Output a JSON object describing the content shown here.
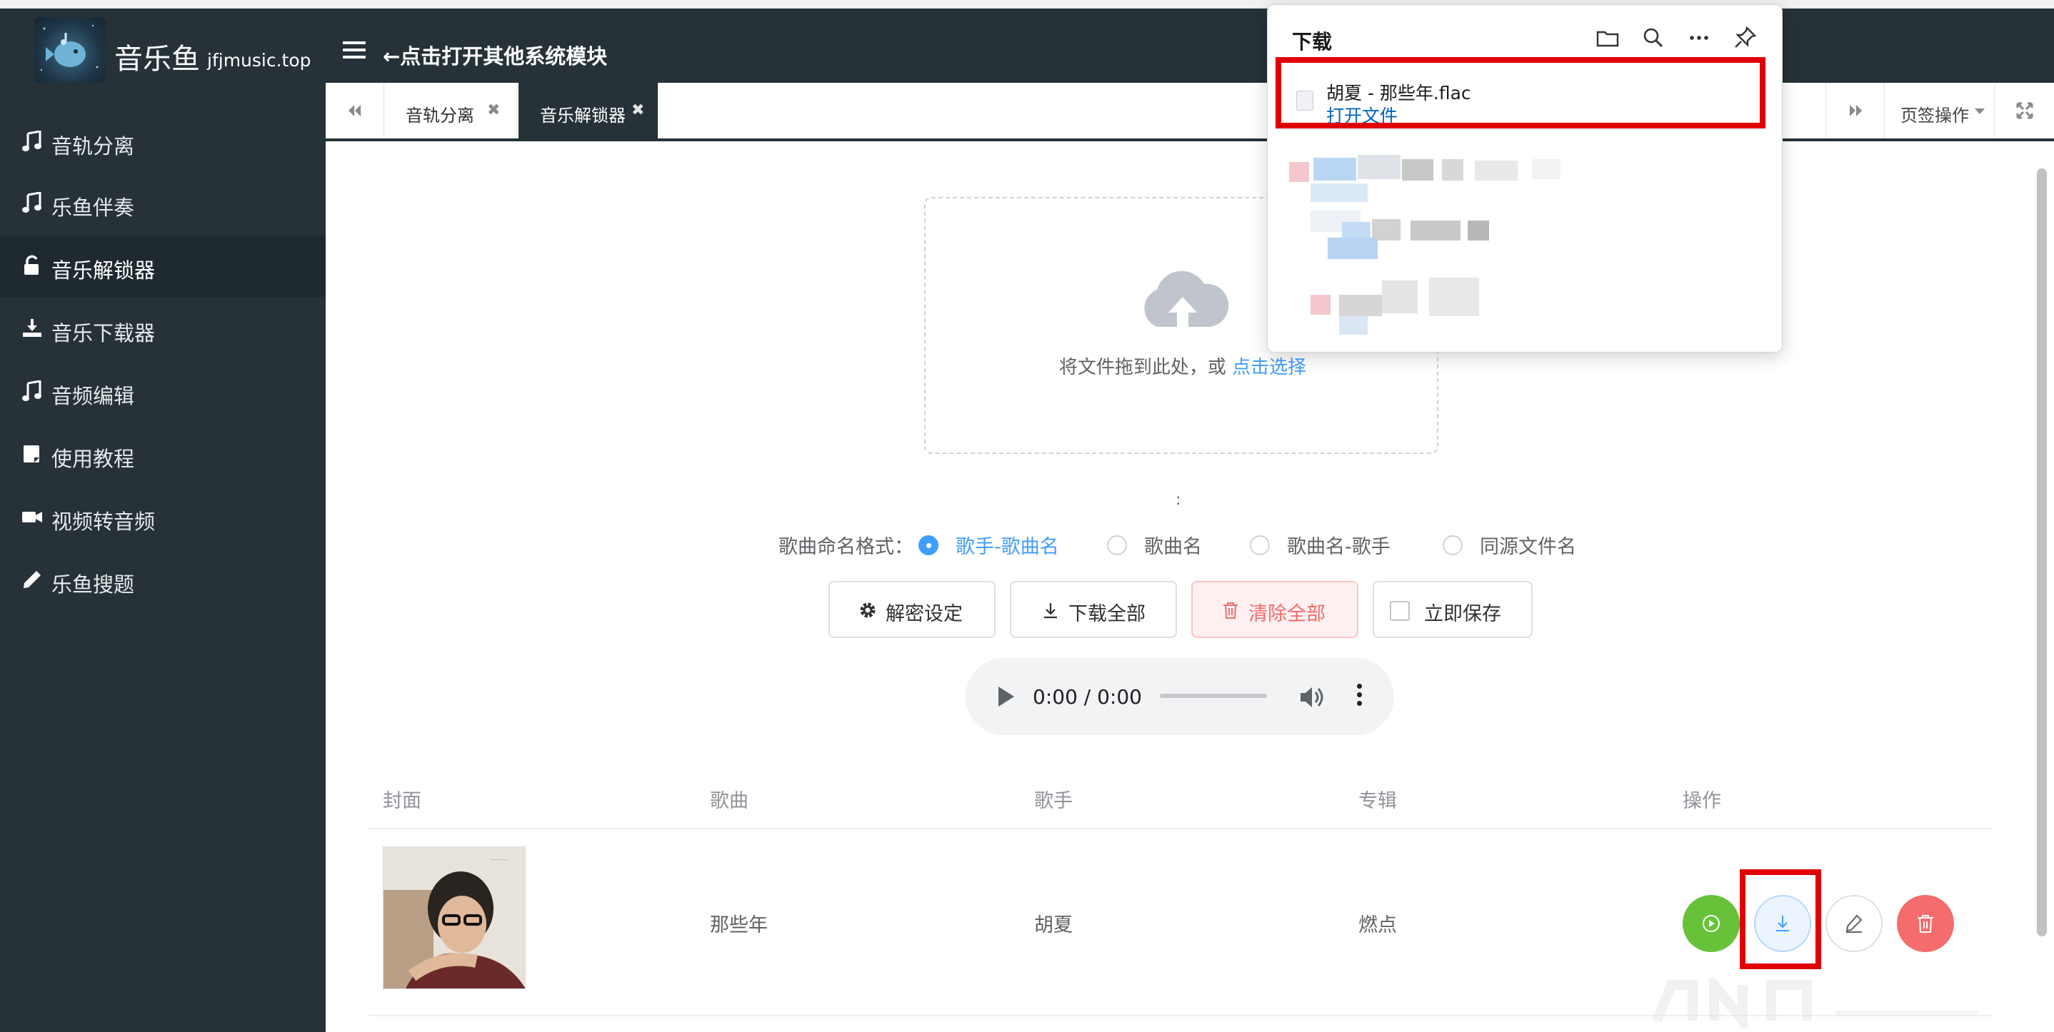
{
  "header": {
    "brand_name": "音乐鱼",
    "brand_url": "jfjmusic.top",
    "hint": "←点击打开其他系统模块"
  },
  "sidebar": {
    "items": [
      {
        "label": "音轨分离",
        "icon": "music-note-icon"
      },
      {
        "label": "乐鱼伴奏",
        "icon": "music-note-icon"
      },
      {
        "label": "音乐解锁器",
        "icon": "unlock-icon",
        "active": true
      },
      {
        "label": "音乐下载器",
        "icon": "download-icon"
      },
      {
        "label": "音频编辑",
        "icon": "music-note-icon"
      },
      {
        "label": "使用教程",
        "icon": "book-icon"
      },
      {
        "label": "视频转音频",
        "icon": "video-camera-icon"
      },
      {
        "label": "乐鱼搜题",
        "icon": "pencil-icon"
      }
    ]
  },
  "tabs": {
    "items": [
      {
        "label": "音轨分离",
        "active": false
      },
      {
        "label": "音乐解锁器",
        "active": true
      }
    ],
    "page_ops_label": "页签操作"
  },
  "upload": {
    "text": "将文件拖到此处，或",
    "link": "点击选择"
  },
  "colon_mark": ":",
  "naming": {
    "label": "歌曲命名格式：",
    "options": [
      {
        "label": "歌手-歌曲名",
        "checked": true
      },
      {
        "label": "歌曲名",
        "checked": false
      },
      {
        "label": "歌曲名-歌手",
        "checked": false
      },
      {
        "label": "同源文件名",
        "checked": false
      }
    ]
  },
  "actions": {
    "settings": "解密设定",
    "download_all": "下载全部",
    "clear_all": "清除全部",
    "save_now": "立即保存"
  },
  "player": {
    "time": "0:00 / 0:00"
  },
  "table": {
    "headers": {
      "cover": "封面",
      "song": "歌曲",
      "artist": "歌手",
      "album": "专辑",
      "ops": "操作"
    },
    "rows": [
      {
        "song": "那些年",
        "artist": "胡夏",
        "album": "燃点"
      }
    ]
  },
  "downloads_panel": {
    "title": "下载",
    "file_name": "胡夏 - 那些年.flac",
    "open_file": "打开文件"
  },
  "colors": {
    "sidebar_bg": "#263238",
    "accent": "#409eff",
    "danger": "#f56c6c",
    "success": "#67c23a",
    "highlight": "#e00000"
  }
}
